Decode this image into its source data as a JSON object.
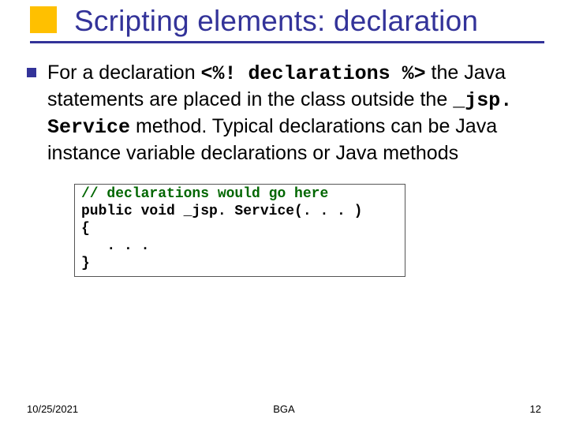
{
  "title": "Scripting elements: declaration",
  "bullet": {
    "seg1": "For a declaration ",
    "code1": "<%! declarations %>",
    "seg2": " the Java statements are placed in the class outside the ",
    "code2": "_jsp. Service",
    "seg3": " method. Typical declarations can be Java instance variable declarations or Java methods"
  },
  "code": {
    "comment": "// declarations would go here",
    "line2": "public void _jsp. Service(. . . )",
    "line3": "{",
    "line4": "   . . .",
    "line5": "}"
  },
  "footer": {
    "left": "10/25/2021",
    "center": "BGA",
    "right": "12"
  }
}
